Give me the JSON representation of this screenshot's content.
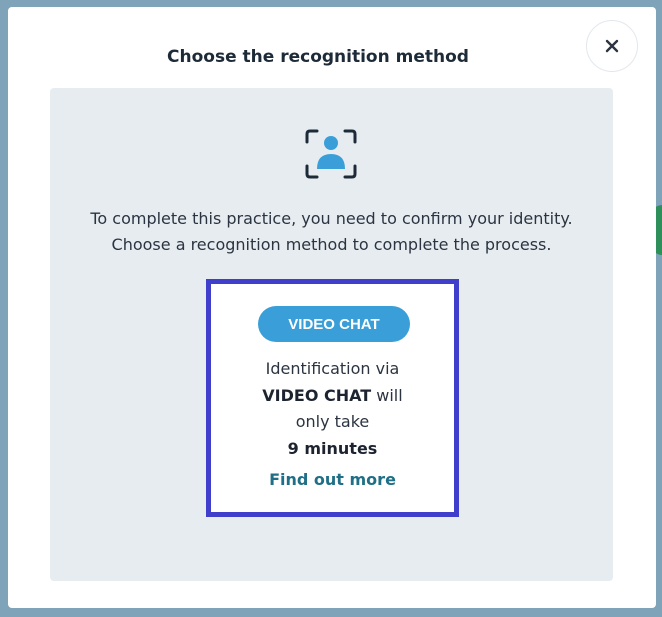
{
  "modal": {
    "title": "Choose the recognition method",
    "close_symbol": "×"
  },
  "panel": {
    "icon": "face-recognition-icon",
    "description_line1": "To complete this practice, you need to confirm your identity.",
    "description_line2": "Choose a recognition method to complete the process."
  },
  "method": {
    "button_label": "VIDEO CHAT",
    "info_line1": "Identification via",
    "info_line2_bold": "VIDEO CHAT",
    "info_line2_rest": " will",
    "info_line3": "only take",
    "info_line4_bold": "9 minutes",
    "link_label": "Find out more"
  },
  "colors": {
    "accent": "#3a9fd8",
    "highlight_border": "#3f3fcb",
    "link": "#1f6f86",
    "panel_bg": "#e7ecf1"
  }
}
